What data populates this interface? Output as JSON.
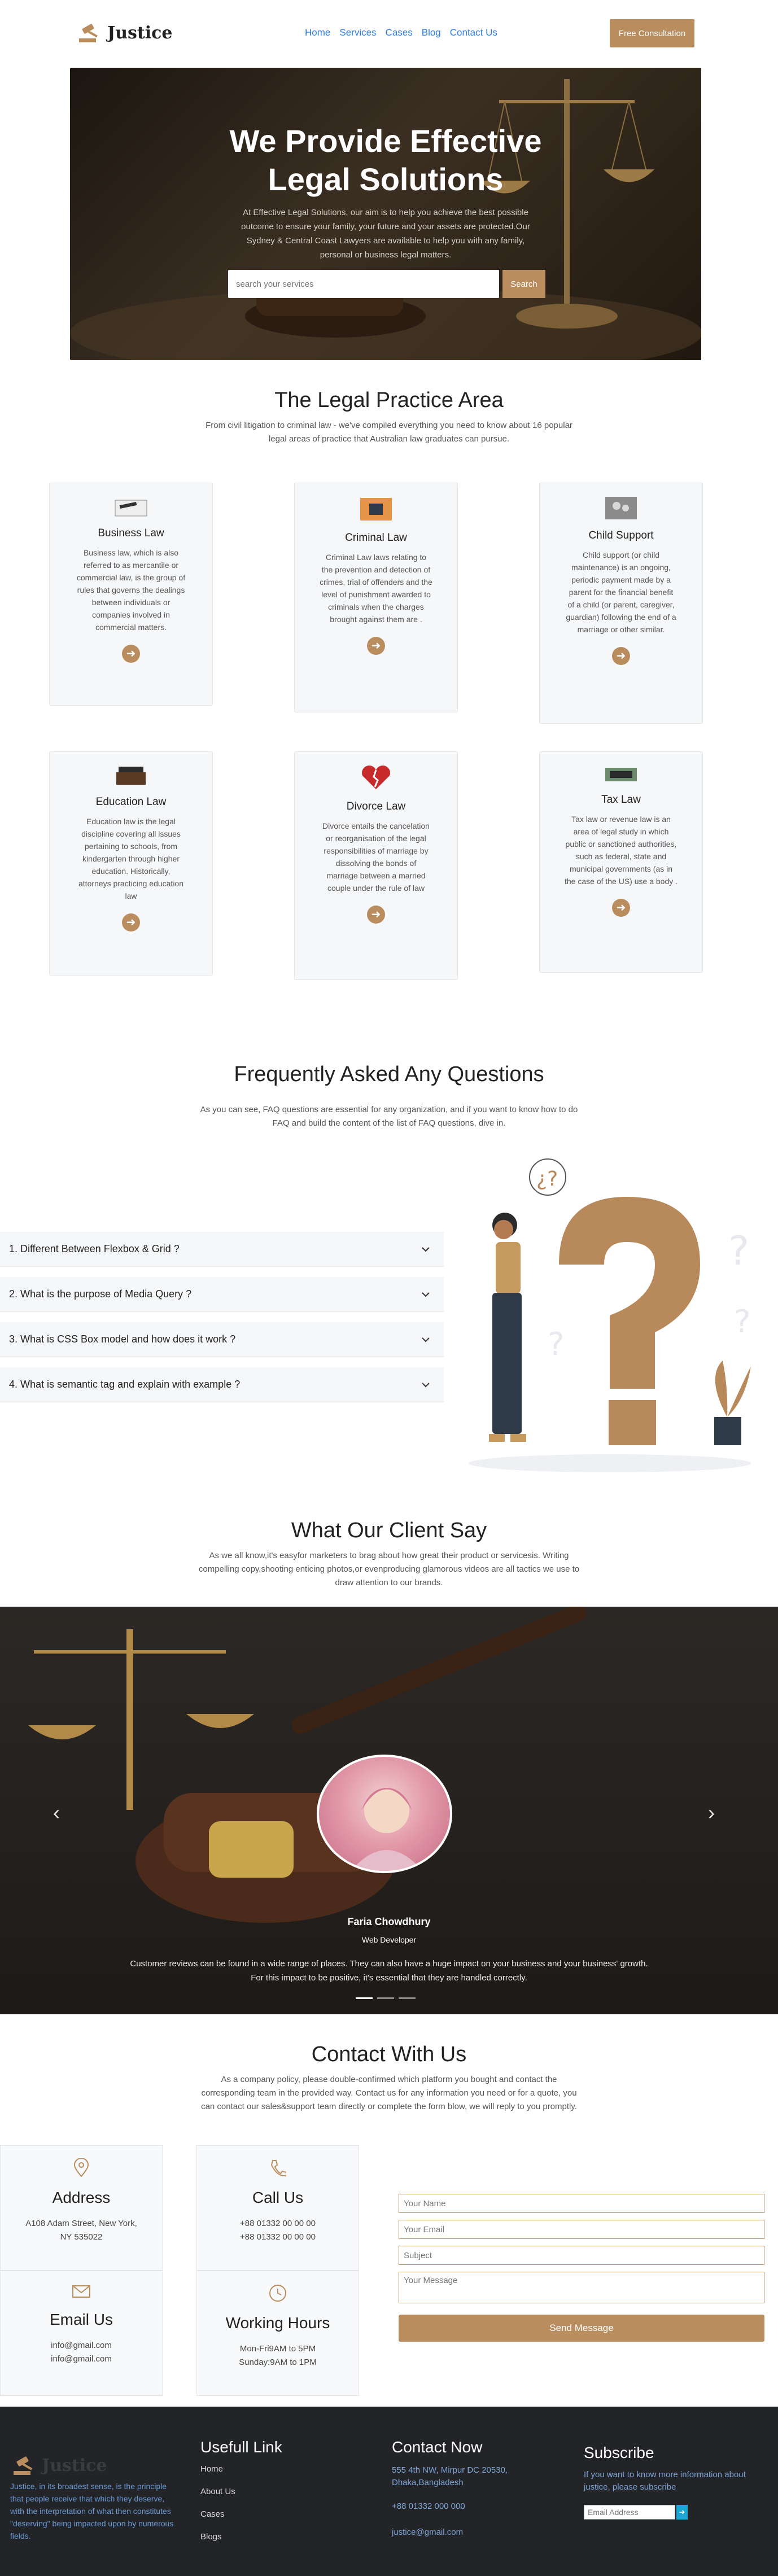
{
  "header": {
    "logo_text": "Justice",
    "nav": [
      "Home",
      "Services",
      "Cases",
      "Blog",
      "Contact Us"
    ],
    "cta": "Free Consultation"
  },
  "hero": {
    "title_line1": "We Provide Effective",
    "title_line2": "Legal Solutions",
    "subtitle": "At Effective Legal Solutions, our aim is to help you achieve the best possible outcome to ensure your family, your future and your assets are protected.Our Sydney & Central Coast Lawyers are available to help you with any family, personal or business legal matters.",
    "search_placeholder": "search your services",
    "search_button": "Search"
  },
  "practice": {
    "title": "The Legal Practice Area",
    "subtitle": "From civil litigation to criminal law - we've compiled everything you need to know about 16 popular legal areas of practice that Australian law graduates can pursue.",
    "cards": [
      {
        "title": "Business Law",
        "text": "Business law, which is also referred to as mercantile or commercial law, is the group of rules that governs the dealings between individuals or companies involved in commercial matters."
      },
      {
        "title": "Criminal Law",
        "text": "Criminal Law laws relating to the prevention and detection of crimes, trial of offenders and the level of punishment awarded to criminals when the charges brought against them are ."
      },
      {
        "title": "Child Support",
        "text": "Child support (or child maintenance) is an ongoing, periodic payment made by a parent for the financial benefit of a child (or parent, caregiver, guardian) following the end of a marriage or other similar."
      },
      {
        "title": "Education Law",
        "text": "Education law is the legal discipline covering all issues pertaining to schools, from kindergarten through higher education. Historically, attorneys practicing education law"
      },
      {
        "title": "Divorce Law",
        "text": "Divorce entails the cancelation or reorganisation of the legal responsibilities of marriage by dissolving the bonds of marriage between a married couple under the rule of law"
      },
      {
        "title": "Tax Law",
        "text": "Tax law or revenue law is an area of legal study in which public or sanctioned authorities, such as federal, state and municipal governments (as in the case of the US) use a body ."
      }
    ]
  },
  "faq": {
    "title": "Frequently Asked Any Questions",
    "subtitle": "As you can see, FAQ questions are essential for any organization, and if you want to know how to do FAQ and build the content of the list of FAQ questions, dive in.",
    "items": [
      "1. Different Between Flexbox & Grid ?",
      "2. What is the purpose of Media Query ?",
      "3. What is CSS Box model and how does it work ?",
      "4. What is semantic tag and explain with example ?"
    ]
  },
  "testimonials": {
    "title": "What Our Client Say",
    "subtitle": "As we all know,it's easyfor marketers to brag about how great their product or servicesis. Writing compelling copy,shooting enticing photos,or evenproducing glamorous videos are all tactics we use to draw attention to our brands.",
    "name": "Faria Chowdhury",
    "role": "Web Developer",
    "text": "Customer reviews can be found in a wide range of places. They can also have a huge impact on your business and your business' growth. For this impact to be positive, it's essential that they are handled correctly."
  },
  "contact": {
    "title": "Contact With Us",
    "subtitle": "As a company policy, please double-confirmed which platform you bought and contact the corresponding team in the provided way. Contact us for any information you need or for a quote, you can contact our sales&support team directly or complete the form blow, we will reply to you promptly.",
    "address_title": "Address",
    "address_lines": [
      "A108 Adam Street, New York,",
      "NY 535022"
    ],
    "call_title": "Call Us",
    "call_lines": [
      "+88 01332 00 00 00",
      "+88 01332 00 00 00"
    ],
    "email_title": "Email Us",
    "email_lines": [
      "info@gmail.com",
      "info@gmail.com"
    ],
    "hours_title": "Working Hours",
    "hours_lines": [
      "Mon-Fri9AM to 5PM",
      "Sunday:9AM to 1PM"
    ],
    "form": {
      "name_placeholder": "Your Name",
      "email_placeholder": "Your Email",
      "subject_placeholder": "Subject",
      "message_placeholder": "Your Message",
      "send": "Send Message"
    }
  },
  "footer": {
    "logo_text": "Justice",
    "about": "Justice, in its broadest sense, is the principle that people receive that which they deserve, with the interpretation of what then constitutes \"deserving\" being impacted upon by numerous fields.",
    "links_title": "Usefull Link",
    "links": [
      "Home",
      "About Us",
      "Cases",
      "Blogs"
    ],
    "contact_title": "Contact Now",
    "contact_address": "555 4th NW, Mirpur DC 20530, Dhaka,Bangladesh",
    "contact_phone": "+88 01332 000 000",
    "contact_email": "justice@gmail.com",
    "subscribe_title": "Subscribe",
    "subscribe_text": "If you want to know more information about justice, please subscribe",
    "subscribe_placeholder": "Email Address"
  },
  "colors": {
    "accent": "#b98d5e",
    "nav_link": "#2b7de9",
    "footer_bg": "#232427"
  }
}
